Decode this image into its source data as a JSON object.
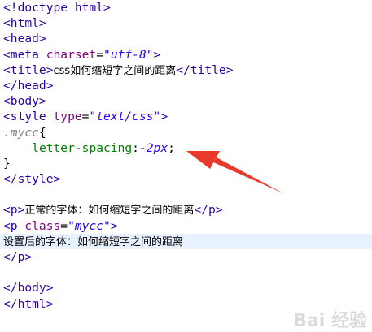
{
  "code": {
    "l1": "<!doctype html>",
    "l2": "<html>",
    "l3": "<head>",
    "l4_open": "<meta ",
    "l4_attr": "charset",
    "l4_eq": "=",
    "l4_val": "\"utf-8\"",
    "l4_close": ">",
    "l5_open": "<title>",
    "l5_text": "css如何缩短字之间的距离",
    "l5_close": "</title>",
    "l6": "</head>",
    "l7": "<body>",
    "l8_open": "<style ",
    "l8_attr": "type",
    "l8_eq": "=",
    "l8_val": "\"text/css\"",
    "l8_close": ">",
    "l9_sel": ".mycc",
    "l9_brace": "{",
    "l10_indent": "    ",
    "l10_prop": "letter-spacing",
    "l10_colon": ":",
    "l10_val": "-2px",
    "l10_semi": ";",
    "l11": "}",
    "l12": "</style>",
    "l13": "",
    "l14_open": "<p>",
    "l14_text": "正常的字体：如何缩短字之间的距离",
    "l14_close": "</p>",
    "l15_open": "<p ",
    "l15_attr": "class",
    "l15_eq": "=",
    "l15_val": "\"mycc\"",
    "l15_close": ">",
    "l16_text": "设置后的字体：如何缩短字之间的距离",
    "l17": "</p>",
    "l18": "",
    "l19": "</body>",
    "l20": "</html>"
  },
  "watermark": "Bai 经验",
  "colors": {
    "arrow": "#e8392b",
    "highlight_line": "#e8f2fe"
  }
}
